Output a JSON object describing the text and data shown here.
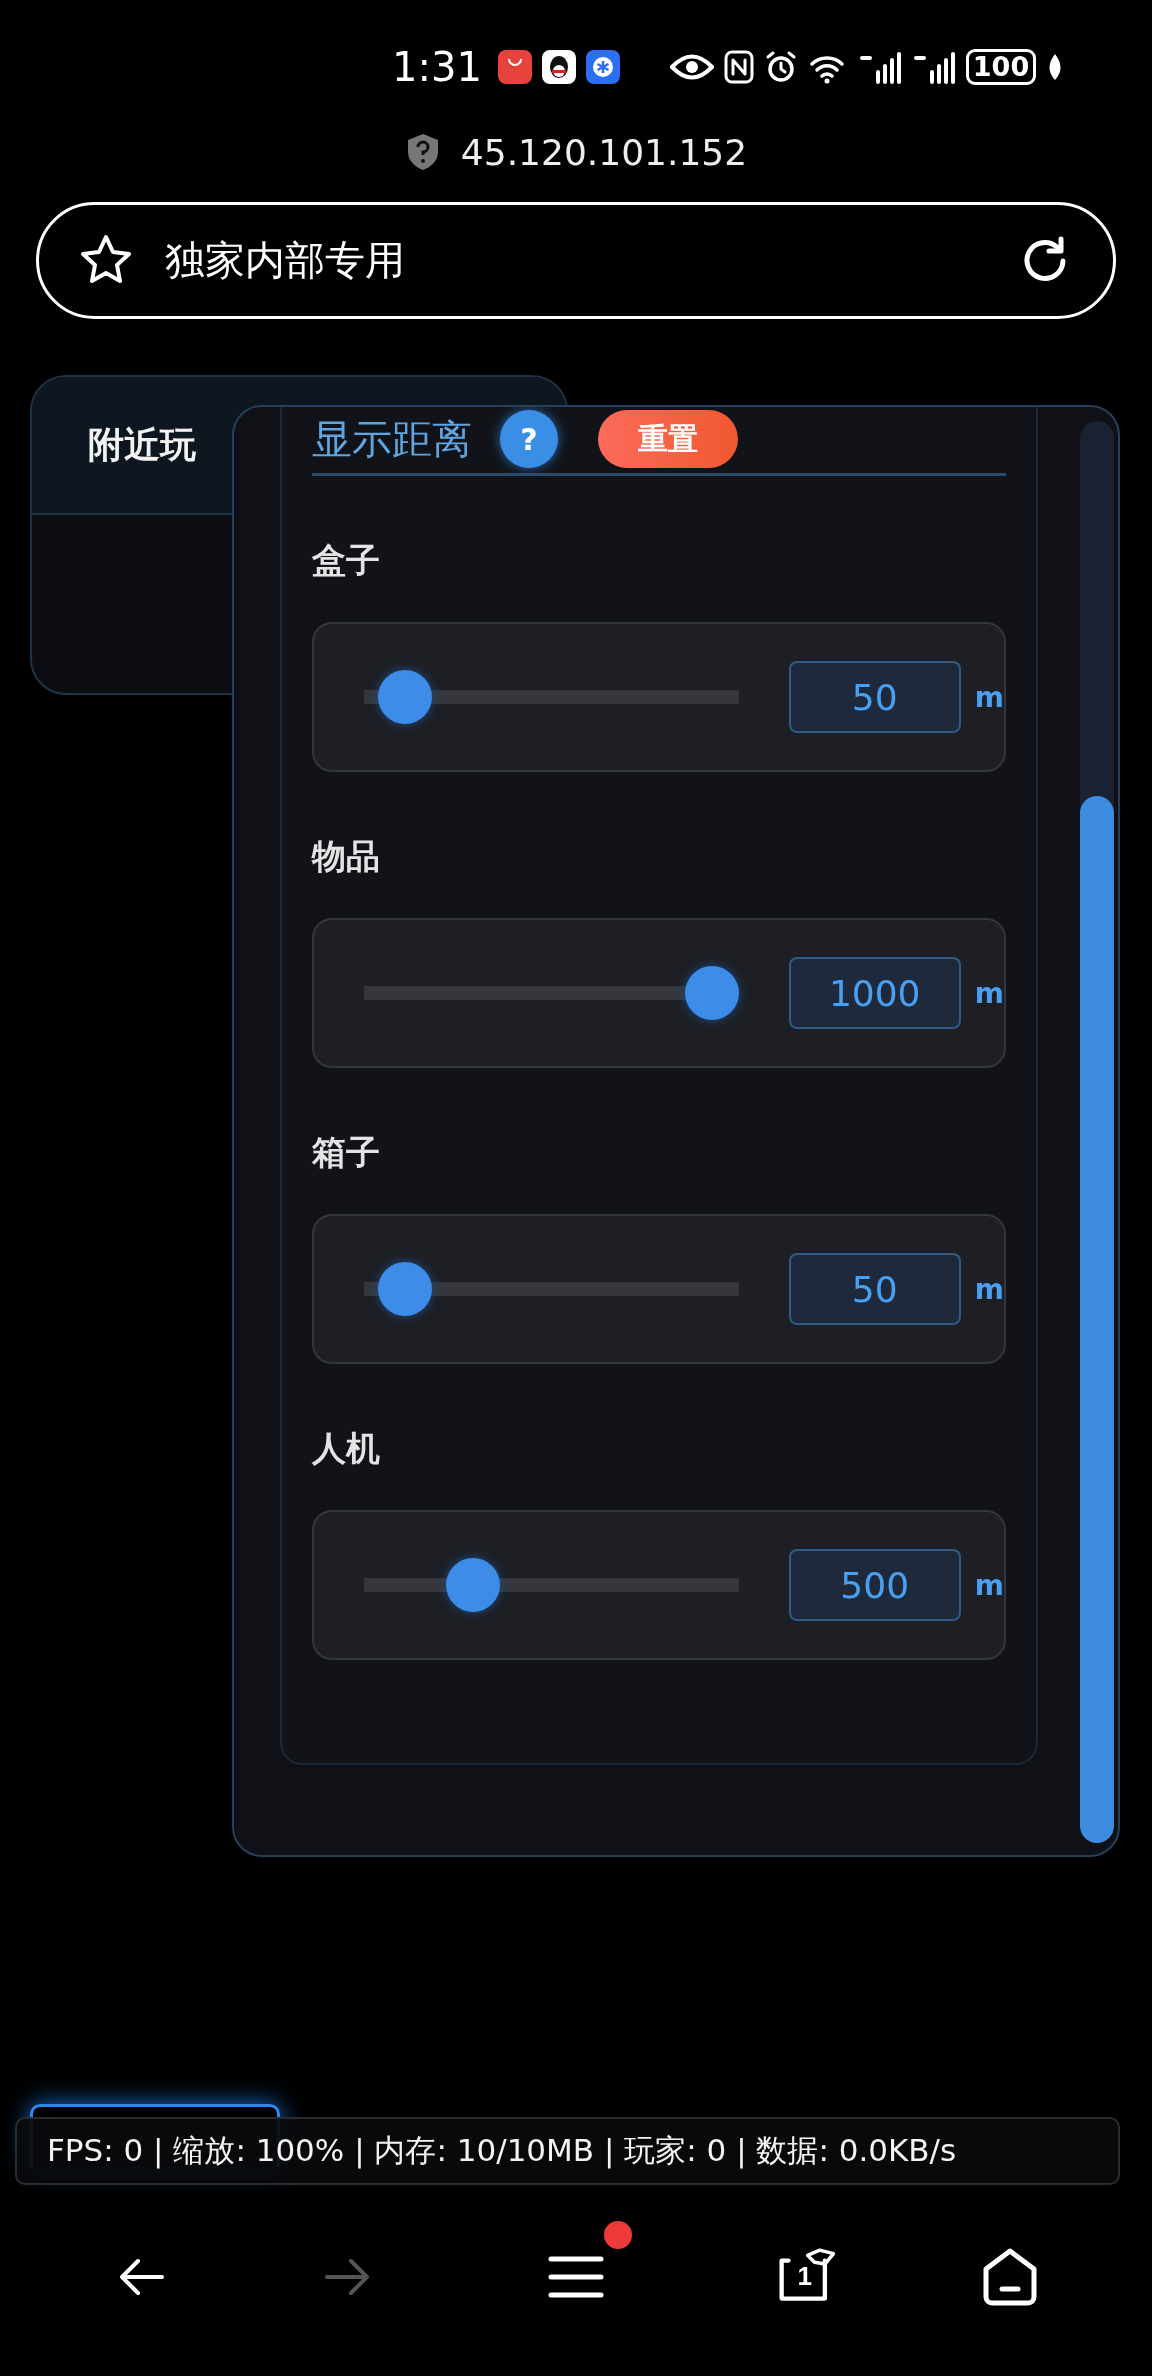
{
  "status_bar": {
    "time": "1:31",
    "battery": "100"
  },
  "url": "45.120.101.152",
  "address_bar": {
    "title": "独家内部专用"
  },
  "back_panel": {
    "title": "附近玩"
  },
  "distance_panel": {
    "title": "显示距离",
    "help": "?",
    "reset": "重置",
    "sliders": [
      {
        "label": "盒子",
        "value": "50",
        "unit": "m",
        "level": 0.11
      },
      {
        "label": "物品",
        "value": "1000",
        "unit": "m",
        "level": 0.93
      },
      {
        "label": "箱子",
        "value": "50",
        "unit": "m",
        "level": 0.11
      },
      {
        "label": "人机",
        "value": "500",
        "unit": "m",
        "level": 0.29
      }
    ]
  },
  "stats": "FPS: 0 | 缩放: 100% | 内存: 10/10MB | 玩家: 0 | 数据: 0.0KB/s",
  "nav": {
    "tabs_count": "1",
    "menu_badge": true
  }
}
